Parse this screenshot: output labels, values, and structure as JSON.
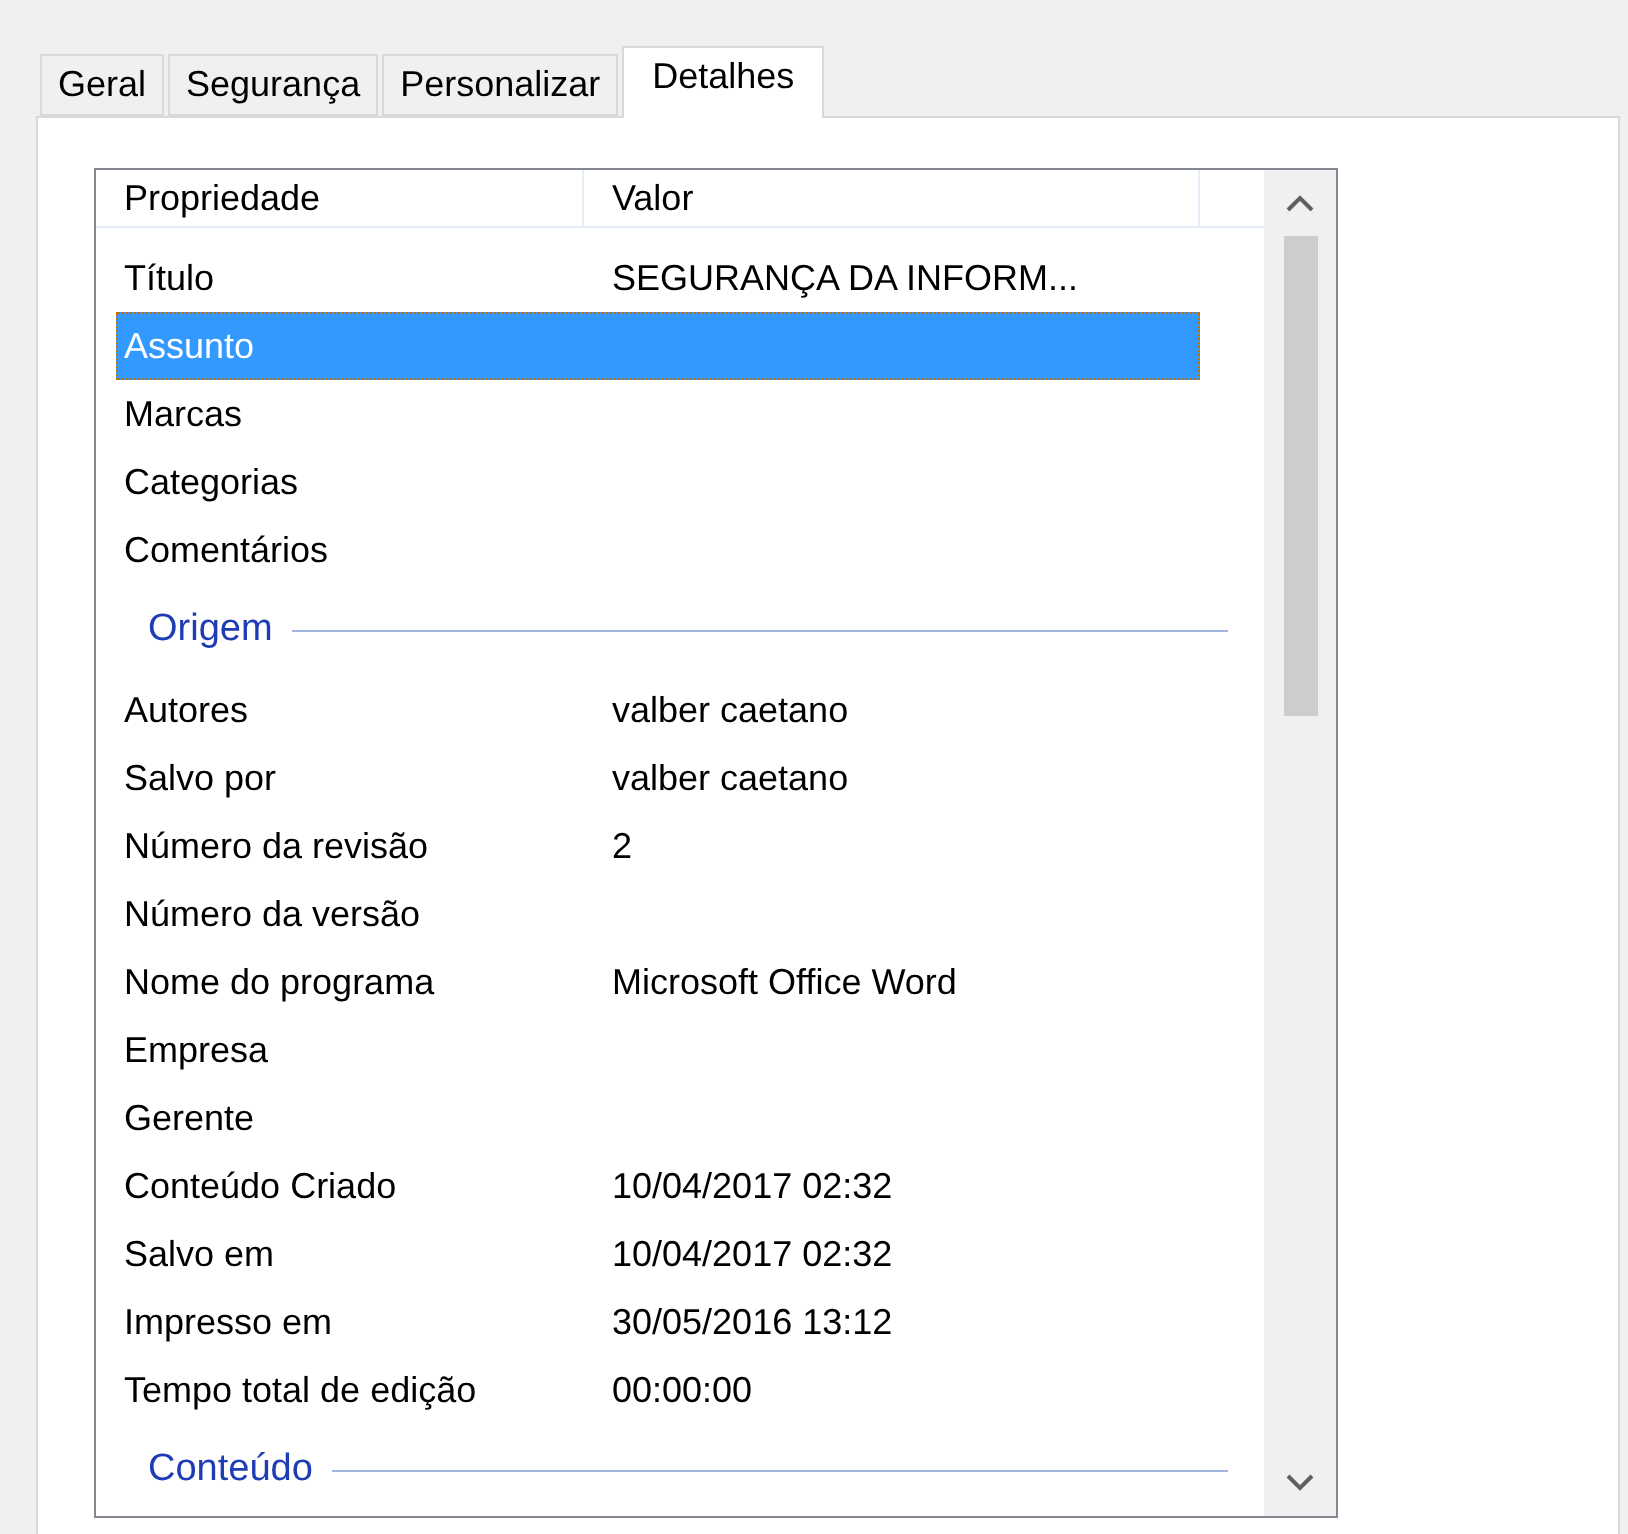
{
  "tabs": [
    {
      "label": "Geral",
      "selected": false
    },
    {
      "label": "Segurança",
      "selected": false
    },
    {
      "label": "Personalizar",
      "selected": false
    },
    {
      "label": "Detalhes",
      "selected": true
    }
  ],
  "list": {
    "columns": [
      "Propriedade",
      "Valor"
    ],
    "items": [
      {
        "kind": "property",
        "name": "Título",
        "value": "SEGURANÇA DA INFORM...",
        "selected": false
      },
      {
        "kind": "property",
        "name": "Assunto",
        "selected": true
      },
      {
        "kind": "property",
        "name": "Marcas",
        "selected": false
      },
      {
        "kind": "property",
        "name": "Categorias",
        "selected": false
      },
      {
        "kind": "property",
        "name": "Comentários",
        "selected": false
      },
      {
        "kind": "group",
        "label": "Origem"
      },
      {
        "kind": "property",
        "name": "Autores",
        "value": "valber caetano",
        "selected": false
      },
      {
        "kind": "property",
        "name": "Salvo por",
        "value": "valber caetano",
        "selected": false
      },
      {
        "kind": "property",
        "name": "Número da revisão",
        "value": "2",
        "selected": false
      },
      {
        "kind": "property",
        "name": "Número da versão",
        "selected": false
      },
      {
        "kind": "property",
        "name": "Nome do programa",
        "value": "Microsoft Office Word",
        "selected": false
      },
      {
        "kind": "property",
        "name": "Empresa",
        "selected": false
      },
      {
        "kind": "property",
        "name": "Gerente",
        "selected": false
      },
      {
        "kind": "property",
        "name": "Conteúdo Criado",
        "value": "10/04/2017 02:32",
        "selected": false
      },
      {
        "kind": "property",
        "name": "Salvo em",
        "value": "10/04/2017 02:32",
        "selected": false
      },
      {
        "kind": "property",
        "name": "Impresso em",
        "value": "30/05/2016 13:12",
        "selected": false
      },
      {
        "kind": "property",
        "name": "Tempo total de edição",
        "value": "00:00:00",
        "selected": false
      },
      {
        "kind": "group",
        "label": "Conteúdo"
      }
    ]
  }
}
